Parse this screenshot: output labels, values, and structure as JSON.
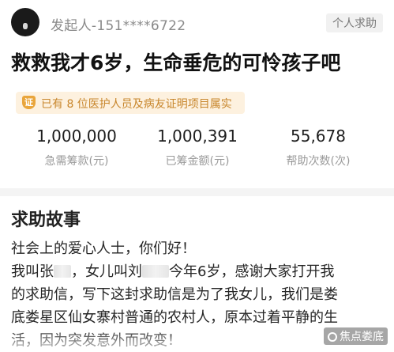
{
  "header": {
    "initiator": "发起人-151****6722",
    "badge": "个人求助"
  },
  "title": "救救我才6岁，生命垂危的可怜孩子吧",
  "verify": {
    "icon_text": "证",
    "text": "已有 8 位医护人员及病友证明项目属实"
  },
  "stats": [
    {
      "value": "1,000,000",
      "label": "急需筹款(元)"
    },
    {
      "value": "1,000,391",
      "label": "已筹金额(元)"
    },
    {
      "value": "55,678",
      "label": "帮助次数(次)"
    }
  ],
  "story": {
    "heading": "求助故事",
    "line1": "社会上的爱心人士，你们好！",
    "line2_a": "我叫张",
    "line2_b": "，女儿叫刘",
    "line2_c": "今年6岁，感谢大家打开我",
    "line3": "的求助信，写下这封求助信是为了我女儿，我们是娄",
    "line4": "底娄星区仙女寨村普通的农村人，原本过着平静的生",
    "line5": "活，因为突发意外而改变！"
  },
  "watermark": "焦点娄底",
  "colors": {
    "accent_orange": "#e9a53b",
    "verify_bg": "#fdf1df",
    "muted_text": "#9a9a9a"
  }
}
